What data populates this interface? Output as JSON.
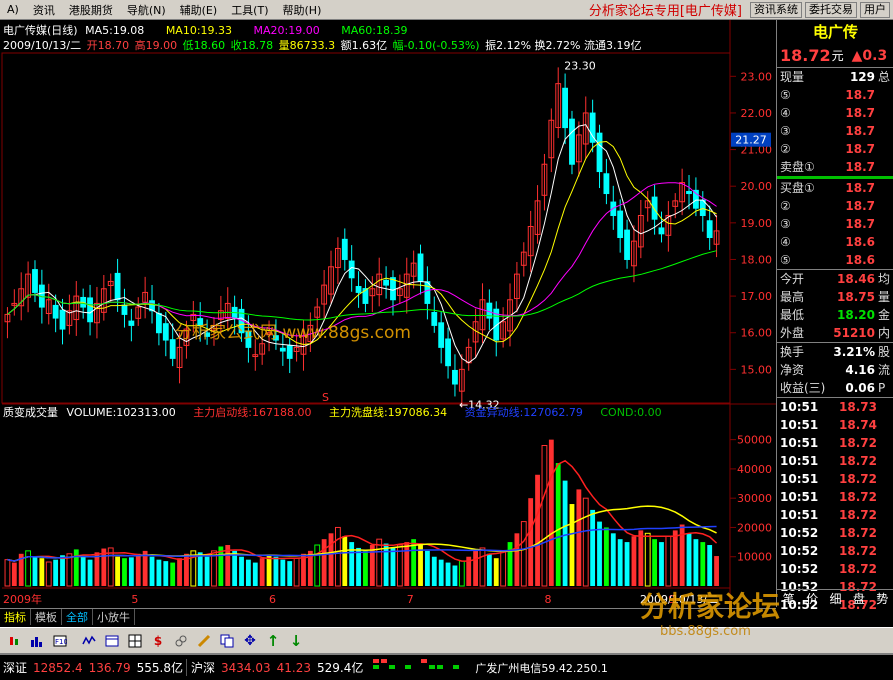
{
  "menu": {
    "items": [
      "A)",
      "资讯",
      "港股期货",
      "导航(N)",
      "辅助(E)",
      "工具(T)",
      "帮助(H)"
    ],
    "title": "分析家论坛专用[电广传媒]",
    "buttons": [
      "资讯系统",
      "委托交易",
      "用户"
    ]
  },
  "chart": {
    "header1": "电广传媒(日线)",
    "ma5": "MA5:19.08",
    "ma10": "MA10:19.33",
    "ma20": "MA20:19.00",
    "ma60": "MA60:18.39",
    "info_date": "2009/10/13/二",
    "info_open": "开18.70",
    "info_high": "高19.00",
    "info_low": "低18.60",
    "info_close": "收18.78",
    "info_vol": "量86733.3",
    "info_amt": "额1.63亿",
    "info_chg": "幅-0.10(-0.53%)",
    "info_rest": "振2.12% 换2.72% 流通3.19亿",
    "price_ticks": [
      "23.00",
      "22.00",
      "21.00",
      "20.00",
      "19.00",
      "18.00",
      "17.00",
      "16.00",
      "15.00"
    ],
    "current_tag": "21.27",
    "max_label": "23.30",
    "min_label": "←14.32",
    "watermark_mid": "分析家公式网 www.88gs.com",
    "ind_name": "质变成交量",
    "ind_vol": "VOLUME:102313.00",
    "ind_main": "主力启动线:167188.00",
    "ind_wash": "主力洗盘线:197086.34",
    "ind_fund": "资金异动线:127062.79",
    "ind_cond": "COND:0.00",
    "vol_ticks": [
      "50000",
      "40000",
      "30000",
      "20000",
      "10000"
    ],
    "date_labels": [
      "2009年",
      "5",
      "6",
      "7",
      "8",
      "9",
      "2009/10/13/二"
    ],
    "s_marker": "S"
  },
  "chart_data": {
    "type": "candlestick",
    "title": "电广传媒(日线)",
    "ylim": [
      14.3,
      23.5
    ],
    "min_close": 14.32,
    "max_high": 23.3,
    "closes": [
      16.5,
      16.8,
      17.2,
      17.6,
      17.1,
      16.7,
      16.9,
      16.4,
      16.1,
      16.6,
      17.0,
      16.7,
      16.3,
      16.8,
      17.2,
      17.4,
      16.9,
      16.5,
      16.2,
      16.7,
      17.1,
      16.6,
      16.0,
      15.8,
      15.3,
      15.6,
      16.1,
      16.5,
      16.2,
      15.9,
      16.2,
      16.6,
      16.8,
      16.4,
      16.0,
      15.6,
      15.4,
      15.7,
      16.0,
      15.8,
      15.5,
      15.3,
      15.6,
      15.9,
      16.2,
      16.7,
      17.3,
      17.8,
      18.3,
      18.0,
      17.5,
      17.1,
      16.8,
      17.2,
      17.6,
      17.3,
      16.9,
      17.2,
      17.6,
      17.9,
      17.4,
      16.8,
      16.2,
      15.6,
      15.1,
      14.6,
      15.0,
      15.6,
      16.3,
      16.9,
      16.4,
      15.8,
      16.3,
      16.9,
      17.6,
      18.2,
      18.9,
      19.6,
      20.6,
      21.8,
      22.8,
      21.6,
      20.6,
      21.4,
      22.0,
      21.2,
      20.4,
      19.8,
      19.2,
      18.6,
      18.0,
      18.5,
      19.2,
      19.6,
      19.1,
      18.7,
      19.2,
      19.6,
      20.1,
      19.8,
      19.4,
      19.2,
      18.6,
      18.78
    ],
    "ma5": 19.08,
    "ma10": 19.33,
    "ma20": 19.0,
    "ma60": 18.39,
    "volume_ylim": [
      0,
      55000
    ],
    "volume_bars": [
      9000,
      8000,
      11000,
      12000,
      10000,
      9500,
      8200,
      9000,
      10500,
      11000,
      12500,
      10000,
      9000,
      11500,
      12800,
      13000,
      10000,
      9500,
      9800,
      11000,
      12000,
      10000,
      9000,
      8500,
      8000,
      9500,
      11000,
      12000,
      11500,
      10000,
      12000,
      13500,
      14000,
      12000,
      10000,
      9000,
      8000,
      9500,
      10500,
      10000,
      9000,
      8500,
      9500,
      11000,
      12000,
      14000,
      16000,
      18000,
      20000,
      17000,
      15000,
      13000,
      12000,
      14000,
      16000,
      14500,
      13000,
      14000,
      15000,
      16000,
      14000,
      12000,
      10000,
      9000,
      8000,
      7000,
      8500,
      10000,
      12000,
      13000,
      11000,
      9500,
      12000,
      15000,
      18000,
      22000,
      30000,
      38000,
      48000,
      50000,
      42000,
      36000,
      28000,
      33000,
      30000,
      26000,
      22000,
      20000,
      18000,
      16000,
      15000,
      17000,
      19000,
      18000,
      16000,
      15000,
      17000,
      19000,
      21000,
      18000,
      16000,
      15000,
      14000,
      10231
    ],
    "volume_current": 102313.0,
    "main_start_line": 167188.0,
    "wash_line": 197086.34,
    "fund_line": 127062.79
  },
  "quote": {
    "name": "电广传",
    "price": "18.72",
    "unit": "元",
    "chg": "▲0.3",
    "rows": [
      {
        "label": "现量",
        "value": "129",
        "ext": "总",
        "cls": "white"
      },
      {
        "label": "⑤",
        "value": "18.7",
        "ext": "",
        "cls": "red"
      },
      {
        "label": "④",
        "value": "18.7",
        "ext": "",
        "cls": "red"
      },
      {
        "label": "③",
        "value": "18.7",
        "ext": "",
        "cls": "red"
      },
      {
        "label": "②",
        "value": "18.7",
        "ext": "",
        "cls": "red"
      },
      {
        "label": "卖盘①",
        "value": "18.7",
        "ext": "",
        "cls": "red"
      }
    ],
    "buy_rows": [
      {
        "label": "买盘①",
        "value": "18.7",
        "ext": "",
        "cls": "red"
      },
      {
        "label": "②",
        "value": "18.7",
        "ext": "",
        "cls": "red"
      },
      {
        "label": "③",
        "value": "18.7",
        "ext": "",
        "cls": "red"
      },
      {
        "label": "④",
        "value": "18.6",
        "ext": "",
        "cls": "red"
      },
      {
        "label": "⑤",
        "value": "18.6",
        "ext": "",
        "cls": "red"
      }
    ],
    "stats": [
      {
        "label": "今开",
        "value": "18.46",
        "ext": "均",
        "cls": "red"
      },
      {
        "label": "最高",
        "value": "18.75",
        "ext": "量",
        "cls": "red"
      },
      {
        "label": "最低",
        "value": "18.20",
        "ext": "金",
        "cls": "green"
      },
      {
        "label": "外盘",
        "value": "51210",
        "ext": "内",
        "cls": "red"
      }
    ],
    "stats2": [
      {
        "label": "换手",
        "value": "3.21%",
        "ext": "股",
        "cls": "white"
      },
      {
        "label": "净资",
        "value": "4.16",
        "ext": "流",
        "cls": "white"
      },
      {
        "label": "收益(三)",
        "value": "0.06",
        "ext": "P",
        "cls": "white"
      }
    ],
    "ticks": [
      {
        "time": "10:51",
        "price": "18.73"
      },
      {
        "time": "10:51",
        "price": "18.74"
      },
      {
        "time": "10:51",
        "price": "18.72"
      },
      {
        "time": "10:51",
        "price": "18.72"
      },
      {
        "time": "10:51",
        "price": "18.72"
      },
      {
        "time": "10:51",
        "price": "18.72"
      },
      {
        "time": "10:51",
        "price": "18.72"
      },
      {
        "time": "10:52",
        "price": "18.72"
      },
      {
        "time": "10:52",
        "price": "18.72"
      },
      {
        "time": "10:52",
        "price": "18.72"
      },
      {
        "time": "10:52",
        "price": "18.72"
      },
      {
        "time": "10:52",
        "price": "18.72"
      }
    ],
    "bottom_tabs": [
      "笔",
      "价",
      "细",
      "盘",
      "势"
    ]
  },
  "tabs": [
    "指标",
    "模板",
    "全部",
    "小放牛"
  ],
  "status": {
    "sz_label": "深证",
    "sz_index": "12852.4",
    "sz_chg": "136.79",
    "sz_amt": "555.8亿",
    "hs_label": "沪深",
    "hs_index": "3434.03",
    "hs_chg": "41.23",
    "hs_amt": "529.4亿",
    "broker": "广发广州电信59.42.250.1"
  },
  "watermark": {
    "main": "分析家论坛",
    "url": "bbs.88gs.com"
  },
  "colors": {
    "up": "#ff3030",
    "down": "#00ffff",
    "ma5": "#ffffff",
    "ma10": "#ffff00",
    "ma20": "#ff00ff",
    "ma60": "#00ff00"
  }
}
